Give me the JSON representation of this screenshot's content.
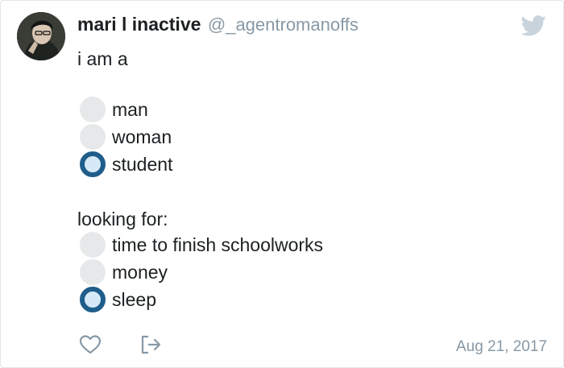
{
  "tweet": {
    "display_name": "mari l inactive",
    "handle": "@_agentromanoffs",
    "intro": "i am a",
    "group1": [
      {
        "label": "man",
        "checked": false
      },
      {
        "label": "woman",
        "checked": false
      },
      {
        "label": "student",
        "checked": true
      }
    ],
    "section_label": "looking for:",
    "group2": [
      {
        "label": "time to finish schoolworks",
        "checked": false
      },
      {
        "label": "money",
        "checked": false
      },
      {
        "label": "sleep",
        "checked": true
      }
    ],
    "date": "Aug 21, 2017"
  },
  "icons": {
    "logo": "twitter-bird-icon",
    "like": "heart-icon",
    "share": "share-icon"
  },
  "colors": {
    "radio_checked": "#1f5d8a",
    "radio_unchecked": "#e6e8e9",
    "secondary_text": "#8899a6"
  }
}
